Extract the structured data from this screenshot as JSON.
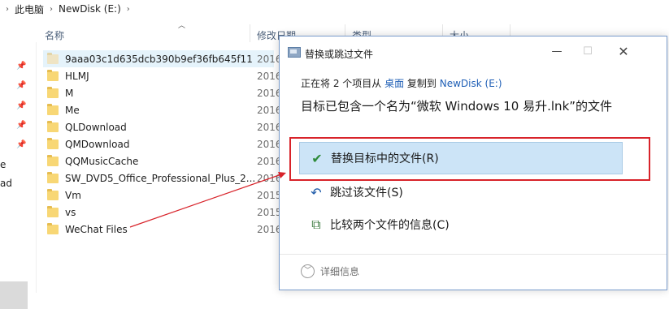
{
  "breadcrumb": [
    "此电脑",
    "NewDisk (E:)"
  ],
  "nav_fragments": [
    "e",
    "ad"
  ],
  "columns": {
    "name": "名称",
    "modified": "修改日期",
    "type": "类型",
    "size": "大小"
  },
  "files": [
    {
      "name": "9aaa03c1d635dcb390b9ef36fb645f11",
      "date": "2016"
    },
    {
      "name": "HLMJ",
      "date": "2016"
    },
    {
      "name": "M",
      "date": "2016"
    },
    {
      "name": "Me",
      "date": "2016"
    },
    {
      "name": "QLDownload",
      "date": "2016"
    },
    {
      "name": "QMDownload",
      "date": "2016"
    },
    {
      "name": "QQMusicCache",
      "date": "2016"
    },
    {
      "name": "SW_DVD5_Office_Professional_Plus_2...",
      "date": "2016"
    },
    {
      "name": "Vm",
      "date": "2015"
    },
    {
      "name": "vs",
      "date": "2015"
    },
    {
      "name": "WeChat Files",
      "date": "2016"
    }
  ],
  "dialog": {
    "title": "替换或跳过文件",
    "progress_prefix": "正在将 2 个项目从 ",
    "progress_source": "桌面",
    "progress_middle": " 复制到 ",
    "progress_dest": "NewDisk (E:)",
    "message": "目标已包含一个名为“微软 Windows 10 易升.lnk”的文件",
    "option_replace": "替换目标中的文件(R)",
    "option_skip": "跳过该文件(S)",
    "option_compare": "比较两个文件的信息(C)",
    "details": "详细信息",
    "icons": {
      "replace": "check-icon",
      "skip": "skip-arrow-icon",
      "compare": "compare-icon",
      "details": "chevron-down-icon"
    }
  },
  "colors": {
    "accent_link": "#1f5fb6",
    "annotation_red": "#d8232a",
    "selected_option": "#cce4f7"
  }
}
